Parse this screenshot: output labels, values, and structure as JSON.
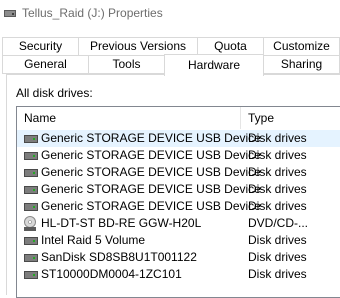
{
  "window": {
    "title": "Tellus_Raid (J:) Properties",
    "icon": "drive-icon"
  },
  "tabs": {
    "top_row": [
      {
        "label": "Security"
      },
      {
        "label": "Previous Versions"
      },
      {
        "label": "Quota"
      },
      {
        "label": "Customize"
      }
    ],
    "bottom_row": [
      {
        "label": "General"
      },
      {
        "label": "Tools"
      },
      {
        "label": "Hardware",
        "active": true
      },
      {
        "label": "Sharing"
      }
    ]
  },
  "hardware": {
    "section_label": "All disk drives:",
    "columns": {
      "name": "Name",
      "type": "Type"
    },
    "rows": [
      {
        "name": "Generic STORAGE DEVICE USB Device",
        "type": "Disk drives",
        "icon": "disk-drive-icon",
        "selected": true
      },
      {
        "name": "Generic STORAGE DEVICE USB Device",
        "type": "Disk drives",
        "icon": "disk-drive-icon"
      },
      {
        "name": "Generic STORAGE DEVICE USB Device",
        "type": "Disk drives",
        "icon": "disk-drive-icon"
      },
      {
        "name": "Generic STORAGE DEVICE USB Device",
        "type": "Disk drives",
        "icon": "disk-drive-icon"
      },
      {
        "name": "Generic STORAGE DEVICE USB Device",
        "type": "Disk drives",
        "icon": "disk-drive-icon"
      },
      {
        "name": "HL-DT-ST BD-RE  GGW-H20L",
        "type": "DVD/CD-...",
        "icon": "optical-drive-icon"
      },
      {
        "name": "Intel Raid 5 Volume",
        "type": "Disk drives",
        "icon": "disk-drive-icon"
      },
      {
        "name": "SanDisk SD8SB8U1T001122",
        "type": "Disk drives",
        "icon": "disk-drive-icon"
      },
      {
        "name": "ST10000DM0004-1ZC101",
        "type": "Disk drives",
        "icon": "disk-drive-icon"
      }
    ]
  },
  "colors": {
    "selection": "#e5f3ff",
    "tab_border": "#d9d9d9",
    "list_border": "#828790",
    "title_text": "#6d6d6d"
  }
}
